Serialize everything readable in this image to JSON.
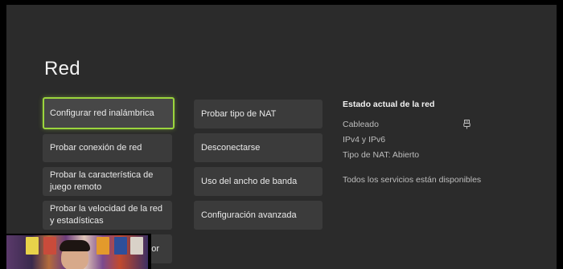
{
  "page": {
    "title": "Red"
  },
  "left_column": [
    {
      "label": "Configurar red inalámbrica",
      "focused": true
    },
    {
      "label": "Probar conexión de red",
      "focused": false
    },
    {
      "label": "Probar la característica de juego remoto",
      "focused": false
    },
    {
      "label": "Probar la velocidad de la red y estadísticas",
      "focused": false
    },
    {
      "label": "or",
      "focused": false
    }
  ],
  "middle_column": [
    {
      "label": "Probar tipo de NAT"
    },
    {
      "label": "Desconectarse"
    },
    {
      "label": "Uso del ancho de banda"
    },
    {
      "label": "Configuración avanzada"
    }
  ],
  "status": {
    "heading": "Estado actual de la red",
    "connection": "Cableado",
    "connection_icon": "ethernet-plug-icon",
    "ip": "IPv4 y IPv6",
    "nat": "Tipo de NAT: Abierto",
    "services": "Todos los servicios están disponibles"
  },
  "colors": {
    "focus": "#9bd53d",
    "background": "#2b2b2b",
    "tile": "#3b3b3b"
  }
}
